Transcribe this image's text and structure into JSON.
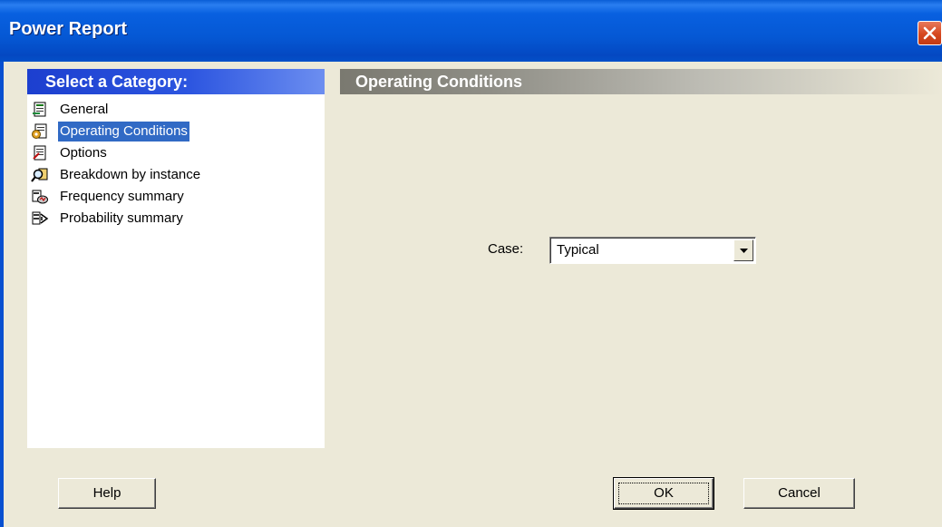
{
  "window": {
    "title": "Power Report"
  },
  "categories": {
    "header": "Select a Category:",
    "items": [
      {
        "label": "General",
        "icon": "document-icon",
        "selected": false
      },
      {
        "label": "Operating Conditions",
        "icon": "document-gear-icon",
        "selected": true
      },
      {
        "label": "Options",
        "icon": "document-checklist-icon",
        "selected": false
      },
      {
        "label": "Breakdown by instance",
        "icon": "magnifier-icon",
        "selected": false
      },
      {
        "label": "Frequency summary",
        "icon": "chart-icon",
        "selected": false
      },
      {
        "label": "Probability summary",
        "icon": "probability-icon",
        "selected": false
      }
    ]
  },
  "section": {
    "title": "Operating Conditions"
  },
  "case": {
    "label": "Case:",
    "value": "Typical"
  },
  "buttons": {
    "help": "Help",
    "ok": "OK",
    "cancel": "Cancel"
  },
  "colors": {
    "titlebar": "#0558d4",
    "category_header": "#2d56e0",
    "selection": "#316ac5",
    "dialog_bg": "#ece9d8",
    "close_button": "#d6471f"
  }
}
